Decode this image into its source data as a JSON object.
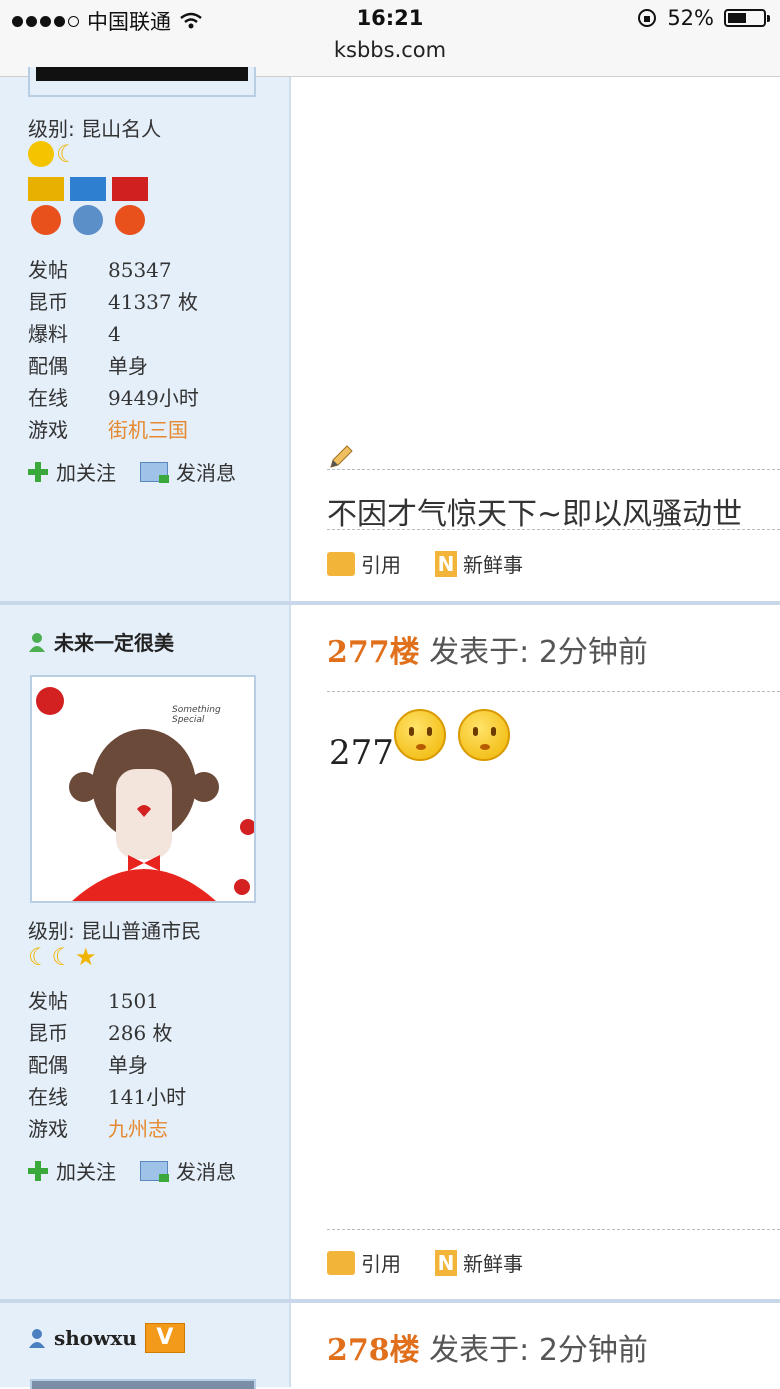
{
  "status": {
    "carrier": "中国联通",
    "time": "16:21",
    "url": "ksbbs.com",
    "battery": "52%",
    "battery_level": 0.52
  },
  "post1": {
    "level": "级别: 昆山名人",
    "stats": [
      {
        "k": "发帖",
        "v": "85347"
      },
      {
        "k": "昆币",
        "v": "41337 枚"
      },
      {
        "k": "爆料",
        "v": "4"
      },
      {
        "k": "配偶",
        "v": "单身"
      },
      {
        "k": "在线",
        "v": "9449小时"
      },
      {
        "k": "游戏",
        "v": "街机三国"
      }
    ],
    "follow": "加关注",
    "message": "发消息",
    "signature": "不因才气惊天下~即以风骚动世",
    "quote": "引用",
    "fresh": "新鲜事"
  },
  "post2": {
    "username": "未来一定很美",
    "avatar_caption": "Something Special",
    "level": "级别: 昆山普通市民",
    "stats": [
      {
        "k": "发帖",
        "v": "1501"
      },
      {
        "k": "昆币",
        "v": "286 枚"
      },
      {
        "k": "配偶",
        "v": "单身"
      },
      {
        "k": "在线",
        "v": "141小时"
      },
      {
        "k": "游戏",
        "v": "九州志"
      }
    ],
    "follow": "加关注",
    "message": "发消息",
    "floor": "277楼",
    "posted": "发表于: 2分钟前",
    "content": "277",
    "quote": "引用",
    "fresh": "新鲜事"
  },
  "post3": {
    "username": "showxu",
    "badge": "V",
    "floor": "278楼",
    "posted": "发表于: 2分钟前"
  }
}
